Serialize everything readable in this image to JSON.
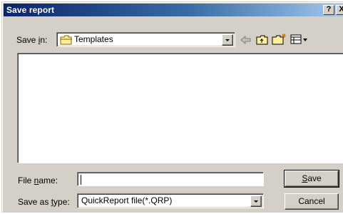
{
  "window": {
    "title": "Save report",
    "help_label": "?",
    "close_label": "X"
  },
  "save_in": {
    "label_pre": "Save ",
    "label_hot": "i",
    "label_post": "n:",
    "value": "Templates"
  },
  "file_name": {
    "label_pre": "File ",
    "label_hot": "n",
    "label_post": "ame:",
    "value": ""
  },
  "save_as_type": {
    "label_pre": "Save as ",
    "label_hot": "t",
    "label_post": "ype:",
    "value": "QuickReport file(*.QRP)"
  },
  "buttons": {
    "save_hot": "S",
    "save_rest": "ave",
    "cancel": "Cancel"
  },
  "icons": {
    "folder": "folder-icon",
    "back": "back-arrow-icon",
    "up": "up-folder-icon",
    "new": "new-folder-icon",
    "views": "view-menu-icon"
  }
}
